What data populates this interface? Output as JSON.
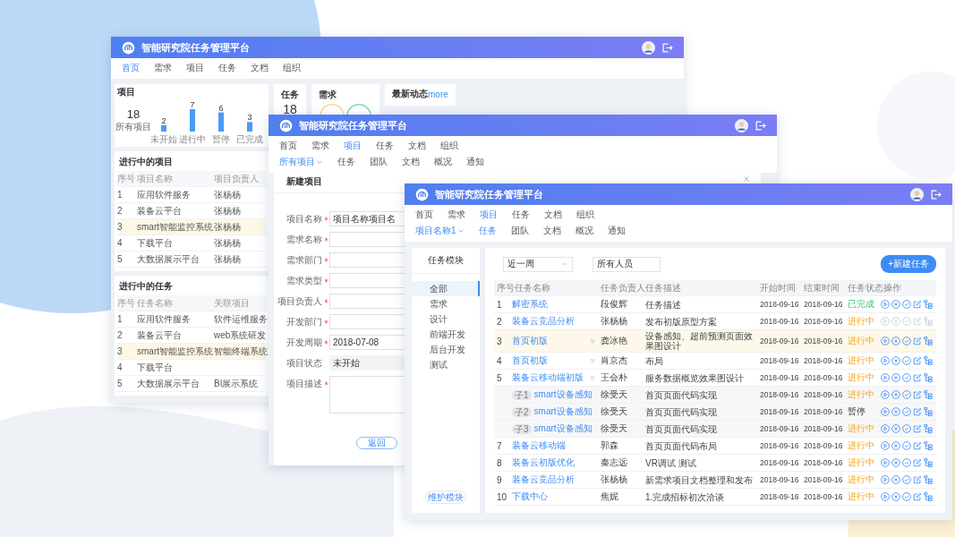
{
  "dashboard_window": {
    "title": "智能研究院任务管理平台",
    "nav": [
      {
        "label": "首页",
        "selected": true
      },
      {
        "label": "需求",
        "selected": false
      },
      {
        "label": "项目",
        "selected": false
      },
      {
        "label": "任务",
        "selected": false
      },
      {
        "label": "文档",
        "selected": false
      },
      {
        "label": "组织",
        "selected": false
      }
    ],
    "project_card": {
      "title": "项目",
      "total": "18",
      "total_label": "所有项目",
      "chart_data": {
        "type": "bar",
        "categories": [
          "未开始",
          "进行中",
          "暂停",
          "已完成"
        ],
        "values": [
          2,
          7,
          6,
          3
        ],
        "data_labels": true
      }
    },
    "task_card": {
      "title": "任务",
      "total": "18"
    },
    "demand_card": {
      "title": "需求"
    },
    "news_card": {
      "title": "最新动态",
      "link": "more"
    },
    "projects_table": {
      "title": "进行中的项目",
      "columns": [
        "序号",
        "项目名称",
        "项目负责人"
      ],
      "rows": [
        {
          "no": "1",
          "name": "应用软件服务",
          "owner": "张杨杨",
          "highlighted": false
        },
        {
          "no": "2",
          "name": "装备云平台",
          "owner": "张杨杨",
          "highlighted": false
        },
        {
          "no": "3",
          "name": "smart智能监控系统",
          "owner": "张杨杨",
          "highlighted": true
        },
        {
          "no": "4",
          "name": "下载平台",
          "owner": "张杨杨",
          "highlighted": false
        },
        {
          "no": "5",
          "name": "大数据展示平台",
          "owner": "张杨杨",
          "highlighted": false
        }
      ]
    },
    "tasks_table": {
      "title": "进行中的任务",
      "columns": [
        "序号",
        "任务名称",
        "关联项目"
      ],
      "rows": [
        {
          "no": "1",
          "name": "应用软件服务",
          "project": "软件运维服务",
          "highlighted": false
        },
        {
          "no": "2",
          "name": "装备云平台",
          "project": "web系统研发",
          "highlighted": false
        },
        {
          "no": "3",
          "name": "smart智能监控系统",
          "project": "智能终端系统",
          "highlighted": true
        },
        {
          "no": "4",
          "name": "下载平台",
          "highlighted": false
        },
        {
          "no": "5",
          "name": "大数据展示平台",
          "project": "BI展示系统",
          "highlighted": false
        }
      ]
    }
  },
  "new_project_window": {
    "title": "智能研究院任务管理平台",
    "nav": [
      {
        "label": "首页",
        "selected": false
      },
      {
        "label": "需求",
        "selected": false
      },
      {
        "label": "项目",
        "selected": true
      },
      {
        "label": "任务",
        "selected": false
      },
      {
        "label": "文档",
        "selected": false
      },
      {
        "label": "组织",
        "selected": false
      }
    ],
    "subnav": [
      {
        "label": "所有项目",
        "kind": "dropdown",
        "selected": true
      },
      {
        "label": "任务",
        "kind": "link",
        "selected": false
      },
      {
        "label": "团队",
        "kind": "link",
        "selected": false
      },
      {
        "label": "文档",
        "kind": "link",
        "selected": false
      },
      {
        "label": "概况",
        "kind": "link",
        "selected": false
      },
      {
        "label": "通知",
        "kind": "link",
        "selected": false
      }
    ],
    "form": {
      "title": "新建项目",
      "fields": [
        {
          "label": "项目名称",
          "required": true,
          "kind": "input",
          "value": "项目名称项目名"
        },
        {
          "label": "需求名称",
          "required": true,
          "kind": "input"
        },
        {
          "label": "需求部门",
          "required": true,
          "kind": "input"
        },
        {
          "label": "需求类型",
          "required": true,
          "kind": "input"
        },
        {
          "label": "项目负责人",
          "required": true,
          "kind": "input"
        },
        {
          "label": "开发部门",
          "required": true,
          "kind": "input"
        },
        {
          "label": "开发周期",
          "required": true,
          "kind": "input",
          "value": "2018-07-08"
        },
        {
          "label": "项目状态",
          "required": false,
          "kind": "select",
          "value": "未开始"
        },
        {
          "label": "项目描述",
          "required": true,
          "kind": "textarea"
        }
      ],
      "button": "返回"
    }
  },
  "task_window": {
    "title": "智能研究院任务管理平台",
    "nav": [
      {
        "label": "首页",
        "selected": false
      },
      {
        "label": "需求",
        "selected": false
      },
      {
        "label": "项目",
        "selected": true
      },
      {
        "label": "任务",
        "selected": false
      },
      {
        "label": "文档",
        "selected": false
      },
      {
        "label": "组织",
        "selected": false
      }
    ],
    "subnav": [
      {
        "label": "项目名称1",
        "kind": "dropdown",
        "selected": true
      },
      {
        "label": "任务",
        "kind": "link",
        "selected": true
      },
      {
        "label": "团队",
        "kind": "link",
        "selected": false
      },
      {
        "label": "文档",
        "kind": "link",
        "selected": false
      },
      {
        "label": "概况",
        "kind": "link",
        "selected": false
      },
      {
        "label": "通知",
        "kind": "link",
        "selected": false
      }
    ],
    "sidebar": {
      "title": "任务模块",
      "items": [
        {
          "label": "全部",
          "selected": true
        },
        {
          "label": "需求",
          "selected": false
        },
        {
          "label": "设计",
          "selected": false
        },
        {
          "label": "前端开发",
          "selected": false
        },
        {
          "label": "后台开发",
          "selected": false
        },
        {
          "label": "测试",
          "selected": false
        }
      ],
      "button": "维护模块"
    },
    "filters": {
      "period": "近一周",
      "people": "所有人员"
    },
    "new_button": "+新建任务",
    "table": {
      "columns": [
        "序号",
        "任务名称",
        "任务负责人",
        "任务描述",
        "开始时间",
        "结束时间",
        "任务状态",
        "操作"
      ],
      "rows": [
        {
          "no": "1",
          "name": "解密系统",
          "expandable": false,
          "owner": "段俊辉",
          "description": "任务描述",
          "start": "2018-09-16",
          "end": "2018-09-16",
          "status": "已完成",
          "done": true,
          "paused": false,
          "highlighted": false,
          "actions_disabled": false
        },
        {
          "no": "2",
          "name": "装备云竞品分析",
          "expandable": false,
          "owner": "张杨杨",
          "description": "发布初版原型方案",
          "start": "2018-09-16",
          "end": "2018-09-16",
          "status": "进行中",
          "done": false,
          "paused": false,
          "highlighted": false,
          "actions_disabled": true
        },
        {
          "no": "3",
          "name": "首页初版",
          "expandable": true,
          "owner": "龚冰艳",
          "description": "设备感知、超前预测页面效果图设计",
          "start": "2018-09-16",
          "end": "2018-09-16",
          "status": "进行中",
          "done": false,
          "paused": false,
          "highlighted": true,
          "actions_disabled": false
        },
        {
          "no": "4",
          "name": "首页初版",
          "expandable": true,
          "owner": "肖京杰",
          "description": "布局",
          "start": "2018-09-16",
          "end": "2018-09-16",
          "status": "进行中",
          "done": false,
          "paused": false,
          "highlighted": false,
          "actions_disabled": false
        },
        {
          "no": "5",
          "name": "装备云移动端初版",
          "expandable": true,
          "owner": "王会朴",
          "description": "服务数据概览效果图设计",
          "start": "2018-09-16",
          "end": "2018-09-16",
          "status": "进行中",
          "done": false,
          "paused": false,
          "highlighted": false,
          "actions_disabled": false,
          "children": [
            {
              "tag": "子1",
              "name": "smart设备感知",
              "owner": "徐受天",
              "description": "首页页面代码实现",
              "start": "2018-09-16",
              "end": "2018-09-16",
              "status": "进行中",
              "done": false,
              "paused": false,
              "actions_disabled": false
            },
            {
              "tag": "子2",
              "name": "smart设备感知",
              "owner": "徐受天",
              "description": "首页页面代码实现",
              "start": "2018-09-16",
              "end": "2018-09-16",
              "status": "暂停",
              "done": false,
              "paused": true,
              "actions_disabled": false
            },
            {
              "tag": "子3",
              "name": "smart设备感知",
              "owner": "徐受天",
              "description": "首页页面代码实现",
              "start": "2018-09-16",
              "end": "2018-09-16",
              "status": "进行中",
              "done": false,
              "paused": false,
              "actions_disabled": false
            }
          ]
        },
        {
          "no": "7",
          "name": "装备云移动端",
          "expandable": false,
          "owner": "郭森",
          "description": "首页页面代码布局",
          "start": "2018-09-16",
          "end": "2018-09-16",
          "status": "进行中",
          "done": false,
          "paused": false,
          "highlighted": false,
          "actions_disabled": false
        },
        {
          "no": "8",
          "name": "装备云初版优化",
          "expandable": false,
          "owner": "秦志远",
          "description": "VR调试 测试",
          "start": "2018-09-16",
          "end": "2018-09-16",
          "status": "进行中",
          "done": false,
          "paused": false,
          "highlighted": false,
          "actions_disabled": false
        },
        {
          "no": "9",
          "name": "装备云竞品分析",
          "expandable": false,
          "owner": "张杨杨",
          "description": "新需求项目文档整理和发布",
          "start": "2018-09-16",
          "end": "2018-09-16",
          "status": "进行中",
          "done": false,
          "paused": false,
          "highlighted": false,
          "actions_disabled": false
        },
        {
          "no": "10",
          "name": "下载中心",
          "expandable": false,
          "owner": "焦妮",
          "description": "1.完成招标初次洽谈",
          "start": "2018-09-16",
          "end": "2018-09-16",
          "status": "进行中",
          "done": false,
          "paused": false,
          "highlighted": false,
          "actions_disabled": false
        }
      ]
    }
  }
}
